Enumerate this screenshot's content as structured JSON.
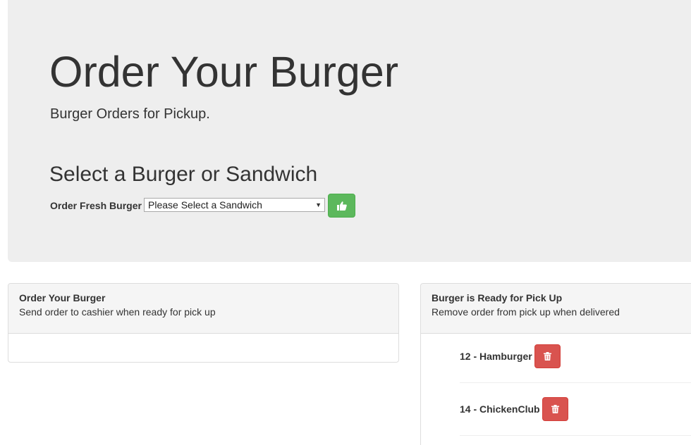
{
  "header": {
    "title": "Order Your Burger",
    "subtitle": "Burger Orders for Pickup."
  },
  "order_form": {
    "heading": "Select a Burger or Sandwich",
    "label": "Order Fresh Burger",
    "select_value": "Please Select a Sandwich",
    "submit_icon": "thumbs-up-icon"
  },
  "pending_panel": {
    "title": "Order Your Burger",
    "subtitle": "Send order to cashier when ready for pick up"
  },
  "ready_panel": {
    "title": "Burger is Ready for Pick Up",
    "subtitle": "Remove order from pick up when delivered",
    "items": [
      {
        "label": "12 - Hamburger",
        "delete_icon": "trash-icon"
      },
      {
        "label": "14 - ChickenClub",
        "delete_icon": "trash-icon"
      }
    ]
  },
  "colors": {
    "success_button": "#5cb85c",
    "danger_button": "#d9534f",
    "jumbotron_bg": "#eeeeee",
    "panel_heading_bg": "#f5f5f5"
  }
}
